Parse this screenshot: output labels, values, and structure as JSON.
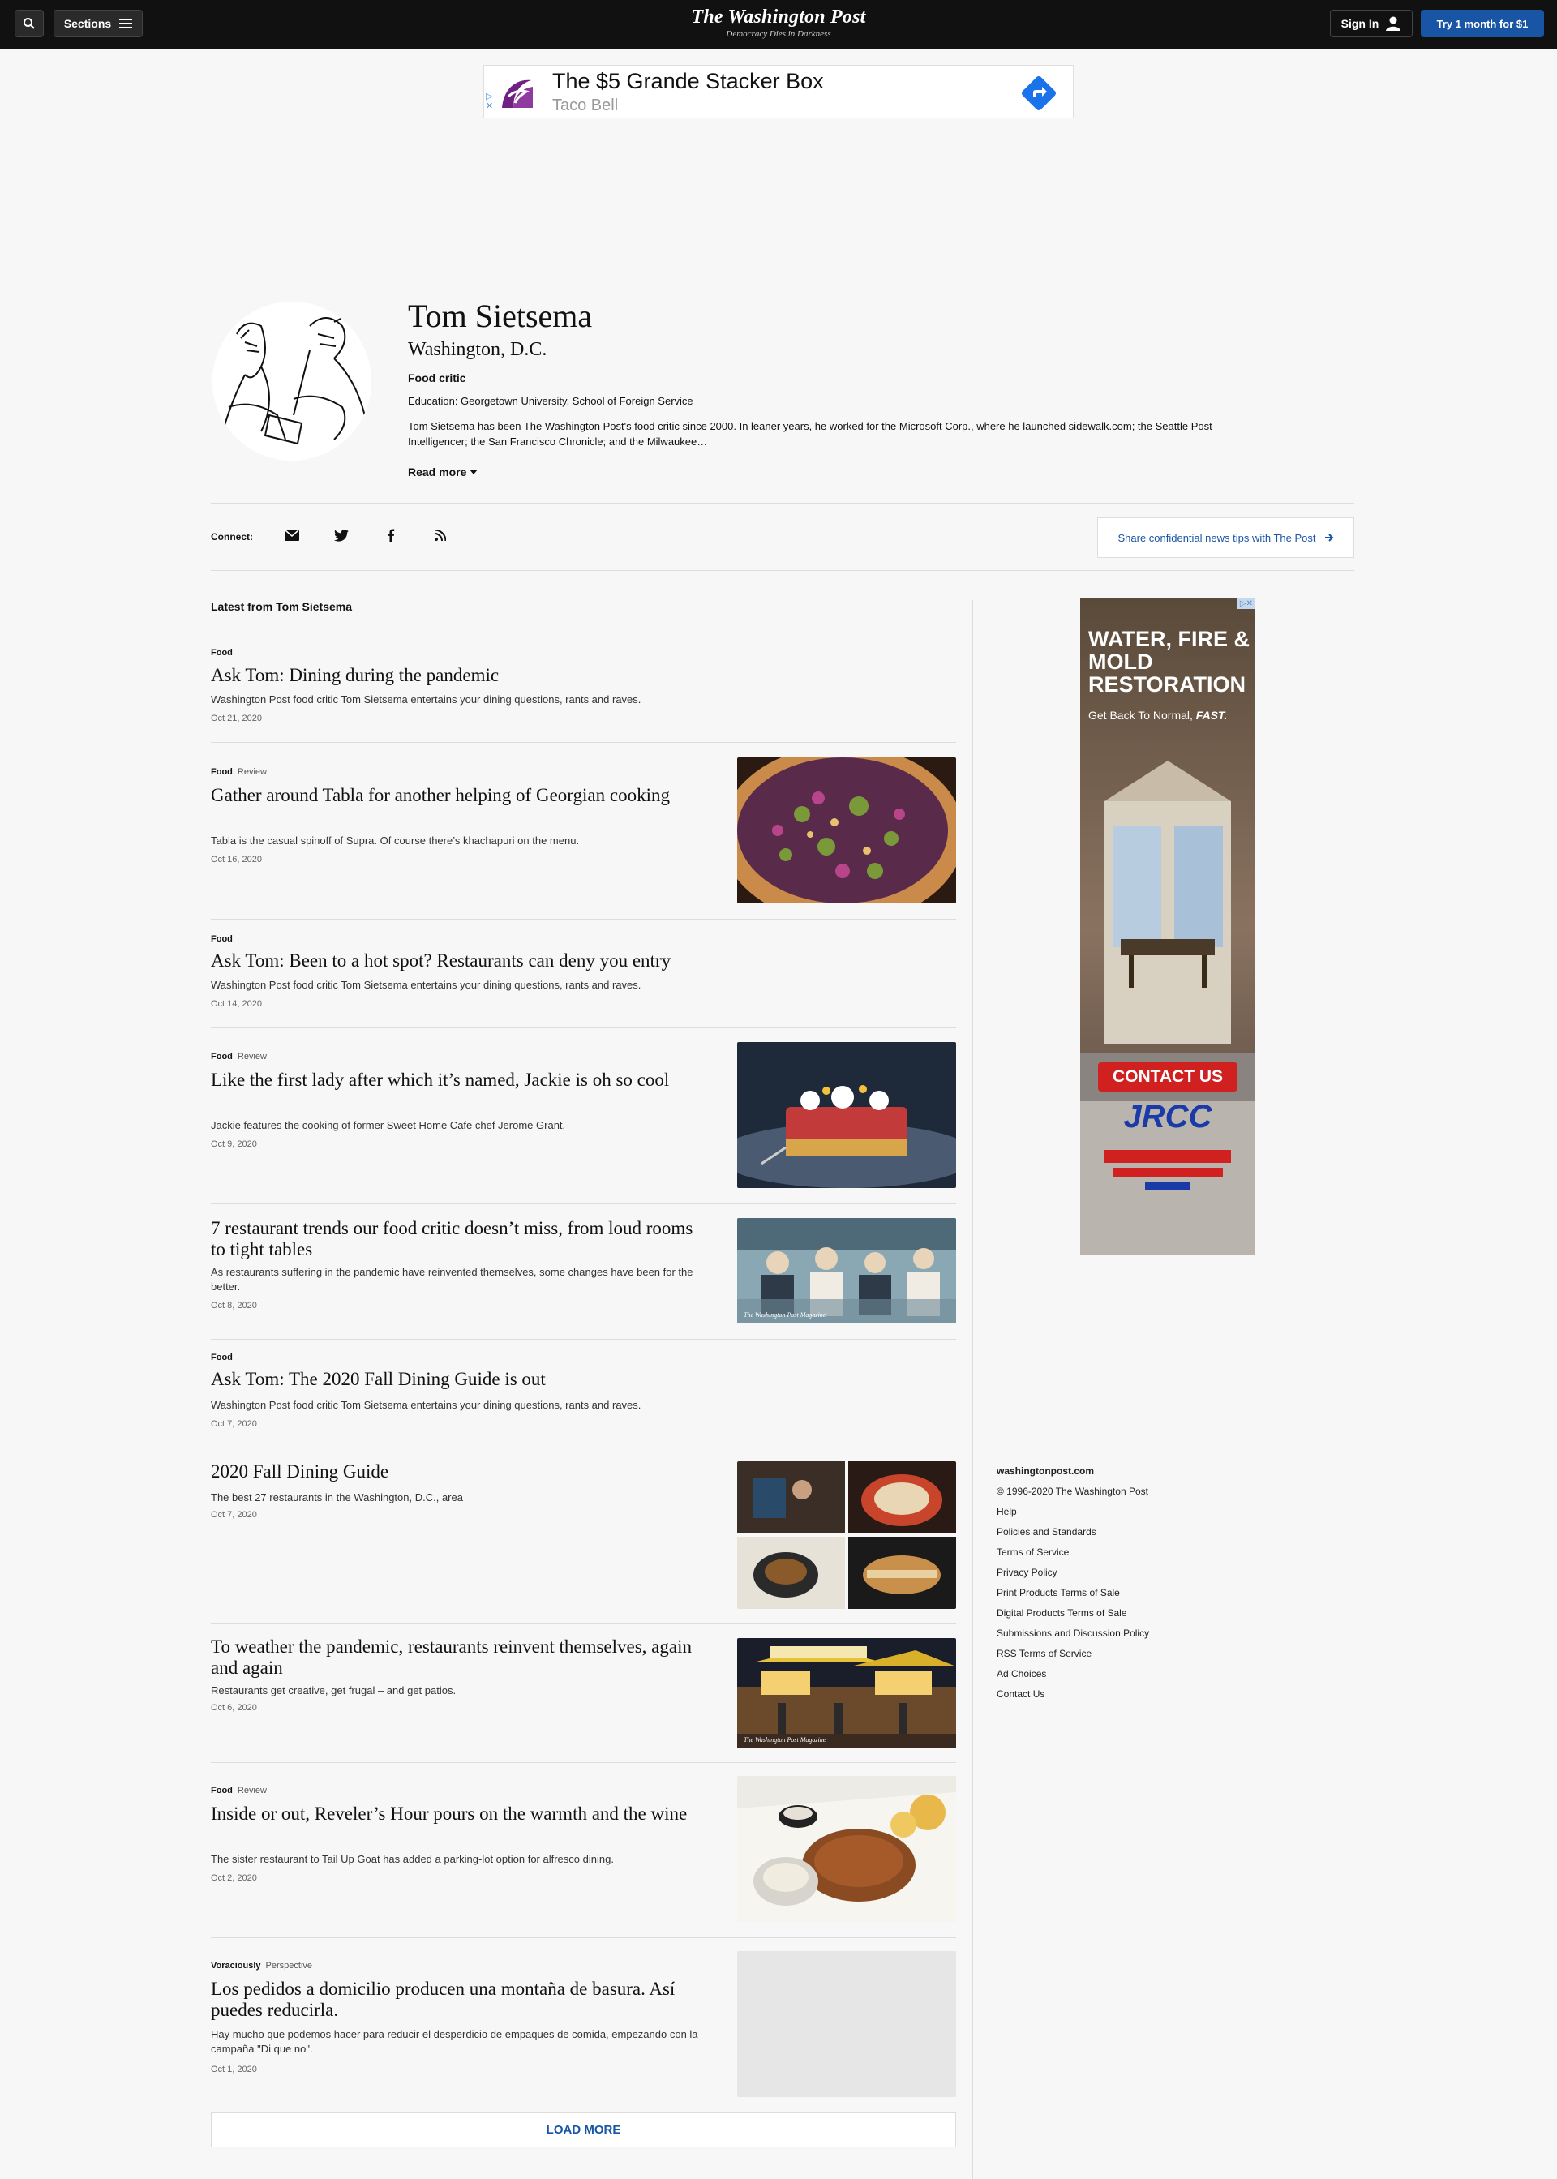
{
  "header": {
    "sections_label": "Sections",
    "logo_name": "The Washington Post",
    "logo_tagline": "Democracy Dies in Darkness",
    "signin_label": "Sign In",
    "subscribe_label": "Try 1 month for $1"
  },
  "ad_top": {
    "title": "The $5 Grande Stacker Box",
    "advertiser": "Taco Bell",
    "adchoices": "▷\n✕"
  },
  "author": {
    "name": "Tom Sietsema",
    "location": "Washington, D.C.",
    "role": "Food critic",
    "education": "Education: Georgetown University, School of Foreign Service",
    "bio": "Tom Sietsema has been The Washington Post's food critic since 2000. In leaner years, he worked for the Microsoft Corp., where he launched sidewalk.com; the Seattle Post-Intelligencer; the San Francisco Chronicle; and the Milwaukee…",
    "read_more": "Read more"
  },
  "connect": {
    "label": "Connect:",
    "tips_label": "Share confidential news tips with The Post"
  },
  "latest": {
    "title": "Latest from Tom Sietsema",
    "articles": [
      {
        "section": "Food",
        "type": "",
        "headline": "Ask Tom: Dining during the pandemic",
        "blurb": "Washington Post food critic Tom Sietsema entertains your dining questions, rants and raves.",
        "date": "Oct 21, 2020"
      },
      {
        "section": "Food",
        "type": "Review",
        "headline": "Gather around Tabla for another helping of Georgian cooking",
        "blurb": "Tabla is the casual spinoff of Supra. Of course there’s khachapuri on the menu.",
        "date": "Oct 16, 2020"
      },
      {
        "section": "Food",
        "type": "",
        "headline": "Ask Tom: Been to a hot spot? Restaurants can deny you entry",
        "blurb": "Washington Post food critic Tom Sietsema entertains your dining questions, rants and raves.",
        "date": "Oct 14, 2020"
      },
      {
        "section": "Food",
        "type": "Review",
        "headline": "Like the first lady after which it’s named, Jackie is oh so cool",
        "blurb": "Jackie features the cooking of former Sweet Home Cafe chef Jerome Grant.",
        "date": "Oct 9, 2020"
      },
      {
        "section": "",
        "type": "",
        "headline": "7 restaurant trends our food critic doesn’t miss, from loud rooms to tight tables",
        "blurb": "As restaurants suffering in the pandemic have reinvented themselves, some changes have been for the better.",
        "date": "Oct 8, 2020"
      },
      {
        "section": "Food",
        "type": "",
        "headline": "Ask Tom: The 2020 Fall Dining Guide is out",
        "blurb": "Washington Post food critic Tom Sietsema entertains your dining questions, rants and raves.",
        "date": "Oct 7, 2020"
      },
      {
        "section": "",
        "type": "",
        "headline": "2020 Fall Dining Guide",
        "blurb": "The best 27 restaurants in the Washington, D.C., area",
        "date": "Oct 7, 2020"
      },
      {
        "section": "",
        "type": "",
        "headline": "To weather the pandemic, restaurants reinvent themselves, again and again",
        "blurb": "Restaurants get creative, get frugal – and get patios.",
        "date": "Oct 6, 2020"
      },
      {
        "section": "Food",
        "type": "Review",
        "headline": "Inside or out, Reveler’s Hour pours on the warmth and the wine",
        "blurb": "The sister restaurant to Tail Up Goat has added a parking-lot option for alfresco dining.",
        "date": "Oct 2, 2020"
      },
      {
        "section": "Voraciously",
        "type": "Perspective",
        "headline": "Los pedidos a domicilio producen una montaña de basura. Así puedes reducirla.",
        "blurb": "Hay mucho que podemos hacer para reducir el desperdicio de empaques de comida, empezando con la campaña \"Di que no\".",
        "date": "Oct 1, 2020"
      }
    ],
    "load_more": "LOAD MORE"
  },
  "magazine_watermark": "The Washington Post Magazine",
  "ad_side": {
    "headline": "WATER, FIRE & MOLD RESTORATION",
    "tagline_a": "Get Back To Normal, ",
    "tagline_b": "FAST.",
    "cta": "CONTACT US",
    "brand": "JRCC",
    "adchoices": "▷✕"
  },
  "footer": {
    "links": [
      "washingtonpost.com",
      "© 1996-2020 The Washington Post",
      "Help",
      "Policies and Standards",
      "Terms of Service",
      "Privacy Policy",
      "Print Products Terms of Sale",
      "Digital Products Terms of Sale",
      "Submissions and Discussion Policy",
      "RSS Terms of Service",
      "Ad Choices",
      "Contact Us"
    ]
  },
  "colors": {
    "accent": "#1955a5",
    "topbar": "#111111",
    "background": "#f7f7f7"
  },
  "icons": [
    "search-icon",
    "menu-icon",
    "user-icon",
    "mail-icon",
    "twitter-icon",
    "facebook-icon",
    "rss-icon",
    "arrow-right-icon",
    "caret-down-icon"
  ]
}
